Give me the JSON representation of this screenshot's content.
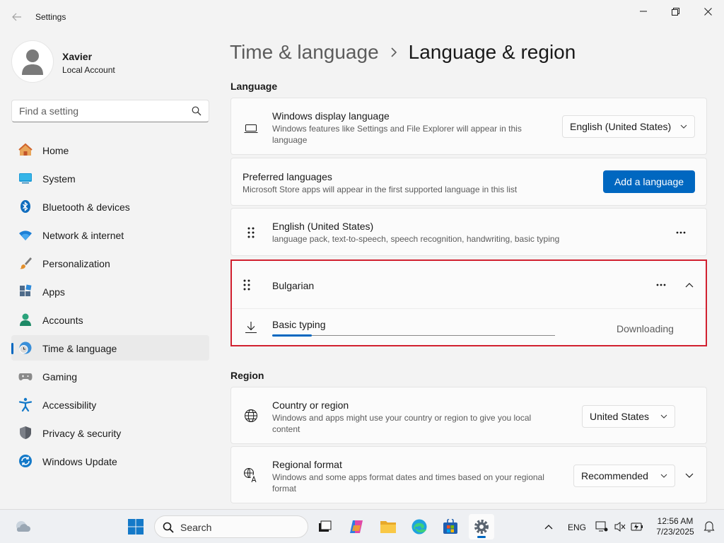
{
  "window": {
    "title": "Settings"
  },
  "profile": {
    "name": "Xavier",
    "account_type": "Local Account"
  },
  "search": {
    "placeholder": "Find a setting"
  },
  "sidebar": {
    "items": [
      {
        "label": "Home",
        "icon": "home-icon"
      },
      {
        "label": "System",
        "icon": "system-icon"
      },
      {
        "label": "Bluetooth & devices",
        "icon": "bluetooth-icon"
      },
      {
        "label": "Network & internet",
        "icon": "wifi-icon"
      },
      {
        "label": "Personalization",
        "icon": "brush-icon"
      },
      {
        "label": "Apps",
        "icon": "apps-icon"
      },
      {
        "label": "Accounts",
        "icon": "accounts-icon"
      },
      {
        "label": "Time & language",
        "icon": "time-language-icon",
        "active": true
      },
      {
        "label": "Gaming",
        "icon": "gamepad-icon"
      },
      {
        "label": "Accessibility",
        "icon": "accessibility-icon"
      },
      {
        "label": "Privacy & security",
        "icon": "shield-icon"
      },
      {
        "label": "Windows Update",
        "icon": "update-icon"
      }
    ]
  },
  "breadcrumb": {
    "parent": "Time & language",
    "current": "Language & region"
  },
  "language_section": {
    "heading": "Language",
    "display_language": {
      "title": "Windows display language",
      "description": "Windows features like Settings and File Explorer will appear in this language",
      "value": "English (United States)"
    },
    "preferred": {
      "title": "Preferred languages",
      "description": "Microsoft Store apps will appear in the first supported language in this list",
      "button": "Add a language"
    },
    "languages": [
      {
        "name": "English (United States)",
        "features": "language pack, text-to-speech, speech recognition, handwriting, basic typing"
      },
      {
        "name": "Bulgarian",
        "feature": "Basic typing",
        "status": "Downloading",
        "progress": 0.14
      }
    ]
  },
  "region_section": {
    "heading": "Region",
    "country": {
      "title": "Country or region",
      "description": "Windows and apps might use your country or region to give you local content",
      "value": "United States"
    },
    "format": {
      "title": "Regional format",
      "description": "Windows and some apps format dates and times based on your regional format",
      "value": "Recommended"
    }
  },
  "taskbar": {
    "search_label": "Search",
    "language_indicator": "ENG",
    "time": "12:56 AM",
    "date": "7/23/2025"
  },
  "colors": {
    "accent": "#0067c0",
    "highlight_border": "#d1202f"
  }
}
